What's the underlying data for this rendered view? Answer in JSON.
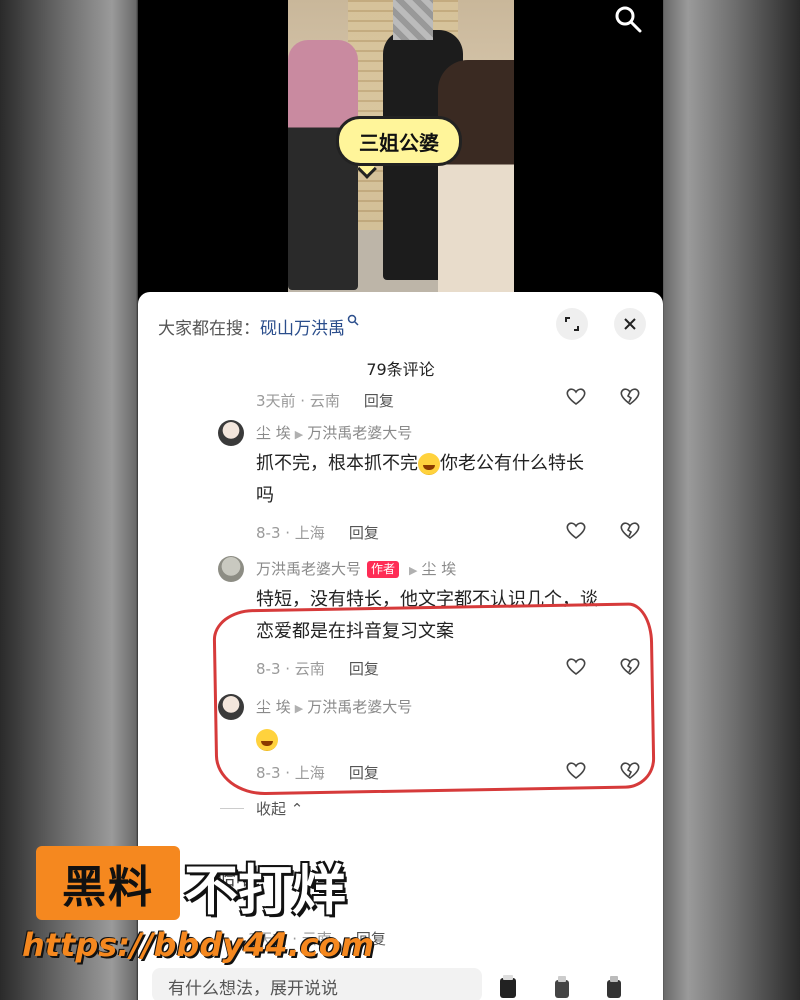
{
  "video": {
    "caption_bubble": "三姐公婆",
    "search_icon": "search-icon"
  },
  "panel": {
    "hot_search_prefix": "大家都在搜：",
    "hot_search_keyword": "砚山万洪禹",
    "expand_icon": "expand-icon",
    "close_icon": "close-icon",
    "comment_count": "79条评论"
  },
  "comments": [
    {
      "meta": "3天前 · 云南",
      "reply": "回复"
    },
    {
      "user": "尘 埃",
      "reply_to": "万洪禹老婆大号",
      "text_line1": "抓不完，根本抓不完",
      "text_line1_after": "你老公有什么特长",
      "text_line2": "吗",
      "meta": "8-3 · 上海",
      "reply": "回复"
    },
    {
      "user": "万洪禹老婆大号",
      "author_tag": "作者",
      "reply_to": "尘 埃",
      "text_line1": "特短，没有特长，他文字都不认识几个，谈",
      "text_line2": "恋爱都是在抖音复习文案",
      "meta": "8-3 · 云南",
      "reply": "回复"
    },
    {
      "user": "尘 埃",
      "reply_to": "万洪禹老婆大号",
      "meta": "8-3 · 上海",
      "reply": "回复"
    }
  ],
  "collapse_label": "收起",
  "partial_comment": {
    "text": "哈哈",
    "meta": "3天前 · 云南",
    "reply": "回复"
  },
  "input": {
    "placeholder": "有什么想法，展开说说"
  },
  "watermark": {
    "box_text": "黑料",
    "white_text": "不打烊",
    "url": "https://bbdy44.com"
  },
  "colors": {
    "accent_red": "#fe2c55",
    "watermark_orange": "#f5881f",
    "highlight_red": "#d63a3a",
    "link_blue": "#2b4e8c"
  }
}
